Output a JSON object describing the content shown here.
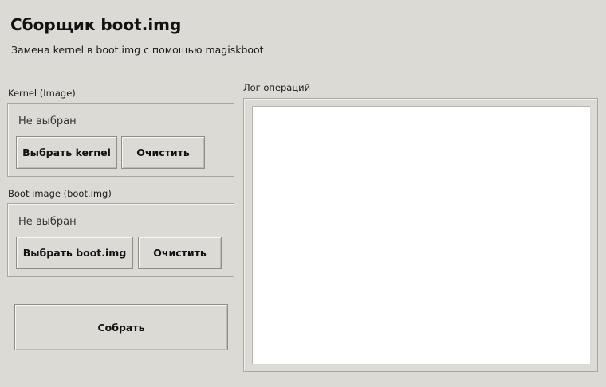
{
  "app": {
    "title": "Сборщик boot.img",
    "subtitle": "Замена kernel в boot.img с помощью magiskboot"
  },
  "kernel_group": {
    "label": "Kernel (Image)",
    "status": "Не выбран",
    "select_button": "Выбрать kernel",
    "clear_button": "Очистить"
  },
  "boot_group": {
    "label": "Boot image (boot.img)",
    "status": "Не выбран",
    "select_button": "Выбрать boot.img",
    "clear_button": "Очистить"
  },
  "build_button": "Собрать",
  "log": {
    "label": "Лог операций",
    "content": ""
  }
}
